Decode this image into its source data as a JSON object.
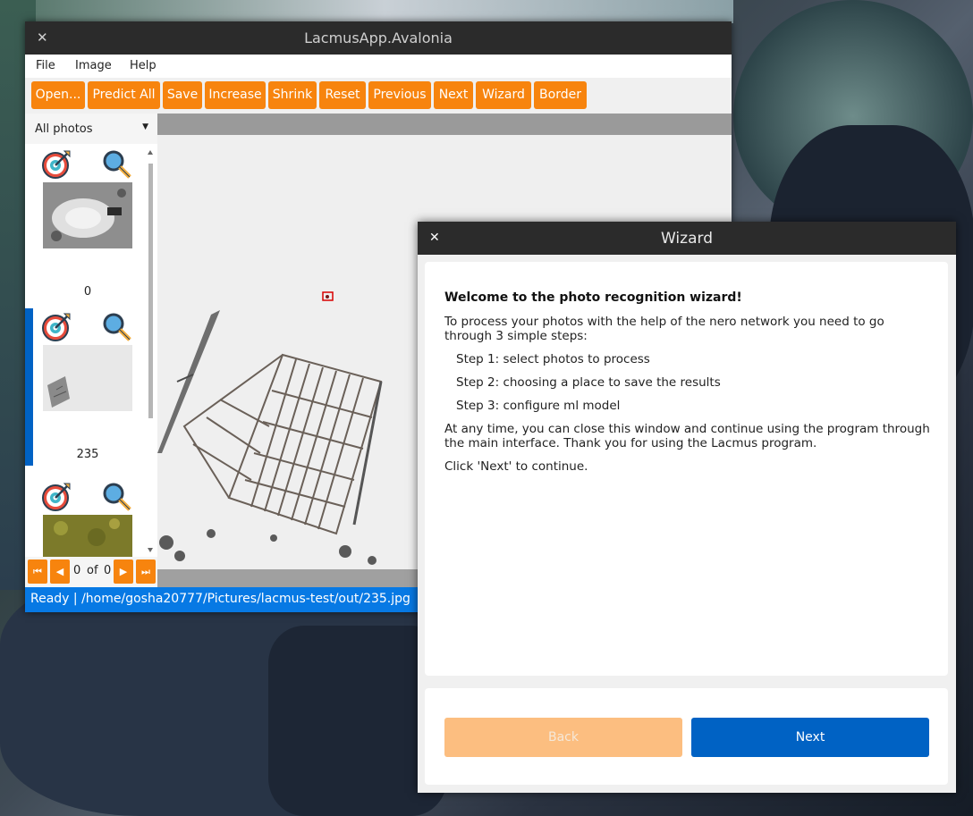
{
  "main_window": {
    "title": "LacmusApp.Avalonia",
    "menu": [
      "File",
      "Image",
      "Help"
    ],
    "toolbar": [
      "Open...",
      "Predict All",
      "Save",
      "Increase",
      "Shrink",
      "Reset",
      "Previous",
      "Next",
      "Wizard",
      "Border"
    ],
    "filter": {
      "selected": "All photos"
    },
    "thumbnails": [
      {
        "number": "0",
        "selected": false
      },
      {
        "number": "235",
        "selected": true
      },
      {
        "number": "",
        "selected": false
      }
    ],
    "pager": {
      "current": "0",
      "of_label": "of",
      "total": "0"
    },
    "status": "Ready | /home/gosha20777/Pictures/lacmus-test/out/235.jpg",
    "colors": {
      "accent": "#f7840e",
      "selection": "#0062c4",
      "status": "#0779e4"
    }
  },
  "wizard": {
    "title": "Wizard",
    "heading": "Welcome to the photo recognition wizard!",
    "intro": "To process your photos with the help of the nero network you need to go through 3 simple steps:",
    "steps": [
      "Step 1: select photos to process",
      "Step 2: choosing a place to save the results",
      "Step 3: configure ml model"
    ],
    "note": "At any time, you can close this window and continue using the program through the main interface. Thank you for using the Lacmus program.",
    "prompt": "Click 'Next' to continue.",
    "back_label": "Back",
    "next_label": "Next",
    "colors": {
      "back_disabled": "#fcbe80",
      "next": "#0062c4"
    }
  }
}
